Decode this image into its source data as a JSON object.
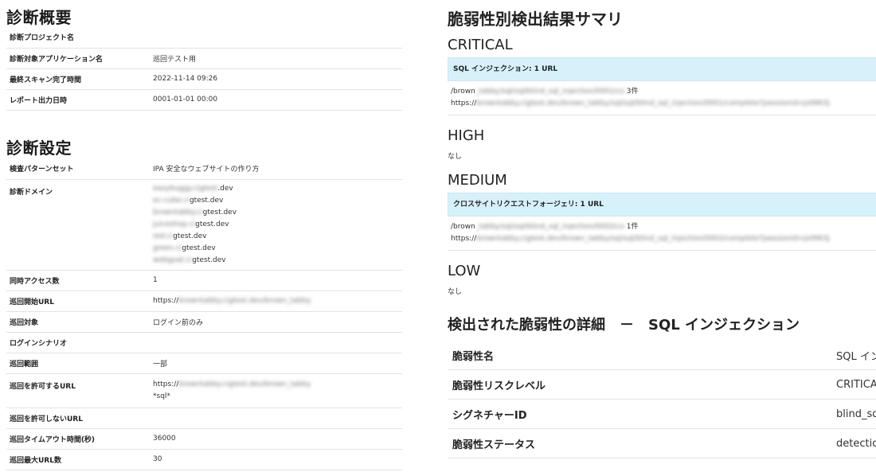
{
  "overview": {
    "title": "診断概要",
    "rows": [
      {
        "key": "診断プロジェクト名",
        "value": ""
      },
      {
        "key": "診断対象アプリケーション名",
        "value": "巡回テスト用"
      },
      {
        "key": "最終スキャン完了時間",
        "value": "2022-11-14 09:26"
      },
      {
        "key": "レポート出力日時",
        "value": "0001-01-01 00:00"
      }
    ]
  },
  "settings": {
    "title": "診断設定",
    "pattern_set": {
      "key": "検査パターンセット",
      "value": "IPA 安全なウェブサイトの作り方"
    },
    "domains": {
      "key": "診断ドメイン",
      "values": [
        {
          "blur": "easybuggy.cigtest",
          "tail": ".dev"
        },
        {
          "blur": "ec-cube.ci",
          "tail": "gtest.dev"
        },
        {
          "blur": "browntabby.ci",
          "tail": "gtest.dev"
        },
        {
          "blur": "juiceshop.ci",
          "tail": "gtest.dev"
        },
        {
          "blur": "red.ci",
          "tail": "gtest.dev"
        },
        {
          "blur": "green.ci",
          "tail": "gtest.dev"
        },
        {
          "blur": "webgoat.ci",
          "tail": "gtest.dev"
        }
      ]
    },
    "concurrency": {
      "key": "同時アクセス数",
      "value": "1"
    },
    "start_url": {
      "key": "巡回開始URL",
      "value_prefix": "https://",
      "value_blur": "browntabby.cigtest.dev/brown_tabby"
    },
    "target": {
      "key": "巡回対象",
      "value": "ログイン前のみ"
    },
    "login": {
      "key": "ログインシナリオ",
      "value": ""
    },
    "scope": {
      "key": "巡回範囲",
      "value": "一部"
    },
    "allow_url": {
      "key": "巡回を許可するURL",
      "value_prefix": "https://",
      "value_blur": "browntabby.cigtest.dev/brown_tabby",
      "value2": "*sql*"
    },
    "deny_url": {
      "key": "巡回を許可しないURL",
      "value": ""
    },
    "timeout": {
      "key": "巡回タイムアウト時間(秒)",
      "value": "36000"
    },
    "max_url": {
      "key": "巡回最大URL数",
      "value": "30"
    }
  },
  "summary": {
    "title": "脆弱性別検出結果サマリ",
    "critical": {
      "label": "CRITICAL",
      "box_title": "SQL インジェクション: 1 URL",
      "line1_prefix": "/brown",
      "line1_blur": "_tabby/sql/sql/blind_sql_injection/0001/co",
      "line1_suffix": " 3件",
      "line2_prefix": "https://",
      "line2_blur": "browntabby.cigtest.dev/brown_tabby/sql/sql/blind_sql_injection/0001/complete?jsessionid=js0963j"
    },
    "high": {
      "label": "HIGH",
      "none": "なし"
    },
    "medium": {
      "label": "MEDIUM",
      "box_title": "クロスサイトリクエストフォージェリ: 1 URL",
      "line1_prefix": "/brown",
      "line1_blur": "_tabby/sql/sql/blind_sql_injection/0002/co",
      "line1_suffix": " 1件",
      "line2_prefix": "https://",
      "line2_blur": "browntabby.cigtest.dev/brown_tabby/sql/sql/blind_sql_injection/0002/complete?jsessionid=js0963j"
    },
    "low": {
      "label": "LOW",
      "none": "なし"
    }
  },
  "detail": {
    "title": "検出された脆弱性の詳細　－　SQL インジェクション",
    "rows": [
      {
        "key": "脆弱性名",
        "value": "SQL イン"
      },
      {
        "key": "脆弱性リスクレベル",
        "value": "CRITICA"
      },
      {
        "key": "シグネチャーID",
        "value": "blind_sq"
      },
      {
        "key": "脆弱性ステータス",
        "value": "detectio"
      }
    ]
  }
}
